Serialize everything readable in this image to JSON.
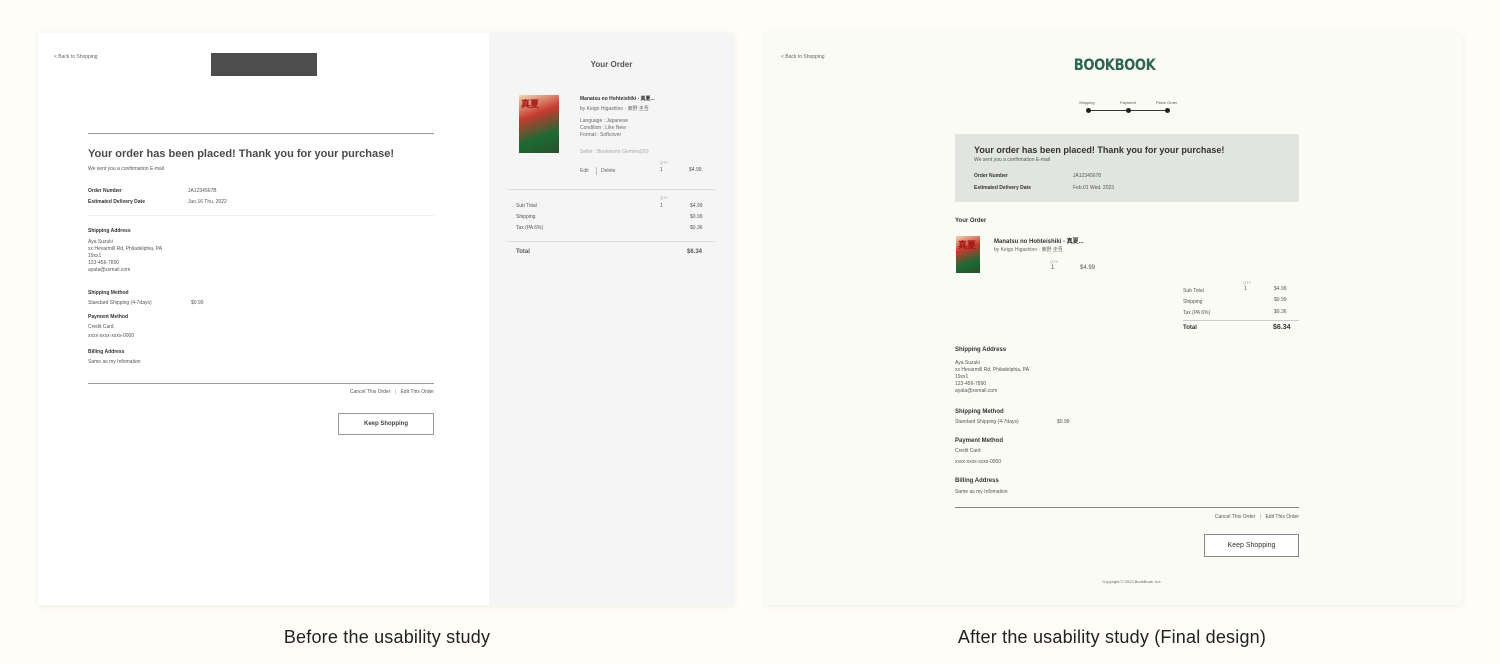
{
  "captions": {
    "before": "Before the usability study",
    "after": "After the usability study (Final design)"
  },
  "before": {
    "back_link": "< Back to Shopping",
    "headline": "Your order has been placed!  Thank you for your purchase!",
    "subtext": "We sent you a confirmation E-mail",
    "order_number_label": "Order Number",
    "order_number": "JA1234567B",
    "eta_label": "Estimated Delivery Date",
    "eta": "Jun.16 Thu, 2022",
    "shipping_address_label": "Shipping Address",
    "address_lines": [
      "Aya Suzuki",
      "xx Hevarmill Rd, Philadelphia, PA",
      "19xx1",
      "123-456-7890",
      "ayata@xxmail.com"
    ],
    "shipping_method_label": "Shipping Method",
    "shipping_method": "Standard Shipping (4-7days)",
    "shipping_method_price": "$0.99",
    "payment_method_label": "Payment Method",
    "payment_method": "Credit Card",
    "card_number": "xxxx-xxxx-xxxx-0000",
    "billing_address_label": "Billing Address",
    "billing_address": "Same as my Infomation",
    "cancel_label": "Cancel This Order",
    "edit_order_label": "Edit This Order",
    "keep_shopping": "Keep Shopping",
    "order_summary": {
      "title": "Your Order",
      "book_title": "Manatsu no Hohteishiki - 真夏...",
      "author": "by Keigo Higashino · 東野 圭吾",
      "language": "Language : Japanese",
      "condition": "Condition : Like New",
      "format": "Format : Softcover",
      "seller": "Seller : Bookworm Gemma(20)",
      "qty_header": "QTY",
      "edit_label": "Edit",
      "delete_label": "Delete",
      "qty": "1",
      "price": "$4.99",
      "subtotal_label": "Sub Total",
      "subtotal_qty": "1",
      "subtotal": "$4.99",
      "shipping_label": "Shipping",
      "shipping": "$0.99",
      "tax_label": "Tax (PA 6%)",
      "tax": "$0.36",
      "total_label": "Total",
      "total": "$6.34"
    }
  },
  "after": {
    "back_link": "< Back to Shopping",
    "logo": "BOOKBOOK",
    "steps": [
      "Shipping",
      "Payment",
      "Place Order"
    ],
    "headline": "Your order has been placed!  Thank you for your purchase!",
    "subtext": "We sent you a confirmation E-mail",
    "order_number_label": "Order Number",
    "order_number": "JA12345678",
    "eta_label": "Estimated Delivery Date",
    "eta": "Feb.01 Wed. 2023",
    "your_order_label": "Your Order",
    "book_title": "Manatsu no Hohteishiki - 真夏...",
    "author": "by Keigo Higashino · 東野 圭吾",
    "qty_header": "QTY",
    "qty": "1",
    "price": "$4.99",
    "subtotal_label": "Sub Total",
    "subtotal_qty": "1",
    "subtotal": "$4.99",
    "shipping_label": "Shipping",
    "shipping": "$0.99",
    "tax_label": "Tax (PA 6%)",
    "tax": "$0.36",
    "total_label": "Total",
    "total": "$6.34",
    "shipping_address_label": "Shipping Address",
    "address_lines": [
      "Aya Suzuki",
      "xx Hevarmill Rd, Philadelphia, PA",
      "19xx1",
      "123-456-7890",
      "ayata@xxmail.com"
    ],
    "shipping_method_label": "Shipping Method",
    "shipping_method": "Standard Shipping (4-7days)",
    "shipping_method_price": "$0.99",
    "payment_method_label": "Payment Method",
    "payment_method": "Credit Card",
    "card_number": "xxxx-xxxx-xxxx-0000",
    "billing_address_label": "Billing Address",
    "billing_address": "Same as my Infomation",
    "cancel_label": "Cancel This Order",
    "edit_order_label": "Edit This Order",
    "keep_shopping": "Keep Shopping",
    "copyright": "Copyright © 2023 BookBook. Inc."
  },
  "colors": {
    "page_bg": "#fffdf7",
    "after_panel_bg": "#fafbf4",
    "logo_green": "#2f6652",
    "banner_bg": "#e2e5df",
    "before_logo_placeholder": "#4d4d4d"
  }
}
